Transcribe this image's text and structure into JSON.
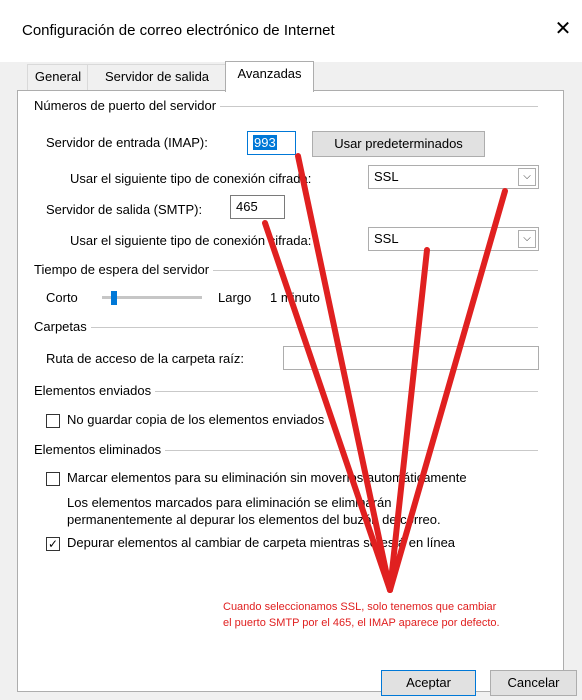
{
  "window": {
    "title": "Configuración de correo electrónico de Internet",
    "close_symbol": "✕"
  },
  "tabs": [
    {
      "label": "General",
      "active": false
    },
    {
      "label": "Servidor de salida",
      "active": false
    },
    {
      "label": "Avanzadas",
      "active": true
    }
  ],
  "ports": {
    "section_title": "Números de puerto del servidor",
    "incoming_label": "Servidor de entrada (IMAP):",
    "incoming_value": "993",
    "defaults_button": "Usar predeterminados",
    "incoming_encryption_label": "Usar el siguiente tipo de conexión cifrada:",
    "incoming_encryption_value": "SSL",
    "outgoing_label": "Servidor de salida (SMTP):",
    "outgoing_value": "465",
    "outgoing_encryption_label": "Usar el siguiente tipo de conexión cifrada:",
    "outgoing_encryption_value": "SSL"
  },
  "timeout": {
    "section_title": "Tiempo de espera del servidor",
    "short_label": "Corto",
    "long_label": "Largo",
    "value_text": "1 minuto",
    "slider_level": 0.1
  },
  "folders": {
    "section_title": "Carpetas",
    "root_label": "Ruta de acceso de la carpeta raíz:",
    "root_value": ""
  },
  "sent": {
    "section_title": "Elementos enviados",
    "no_copy_label": "No guardar copia de los elementos enviados",
    "no_copy_checked": false
  },
  "deleted": {
    "section_title": "Elementos eliminados",
    "mark_label": "Marcar elementos para su eliminación sin moverlos automáticamente",
    "mark_checked": false,
    "info_line1": "Los elementos marcados para eliminación se eliminarán",
    "info_line2": "permanentemente al depurar los elementos del buzón de correo.",
    "purge_label": "Depurar elementos al cambiar de carpeta mientras se está en línea",
    "purge_checked": true
  },
  "annotation": {
    "line1": "Cuando seleccionamos SSL, solo tenemos que cambiar",
    "line2": "el puerto SMTP por el 465, el IMAP aparece por defecto.",
    "color": "#e02020"
  },
  "buttons": {
    "accept": "Aceptar",
    "cancel": "Cancelar"
  },
  "colors": {
    "accent": "#0078d7",
    "annotation_red": "#e02020"
  }
}
